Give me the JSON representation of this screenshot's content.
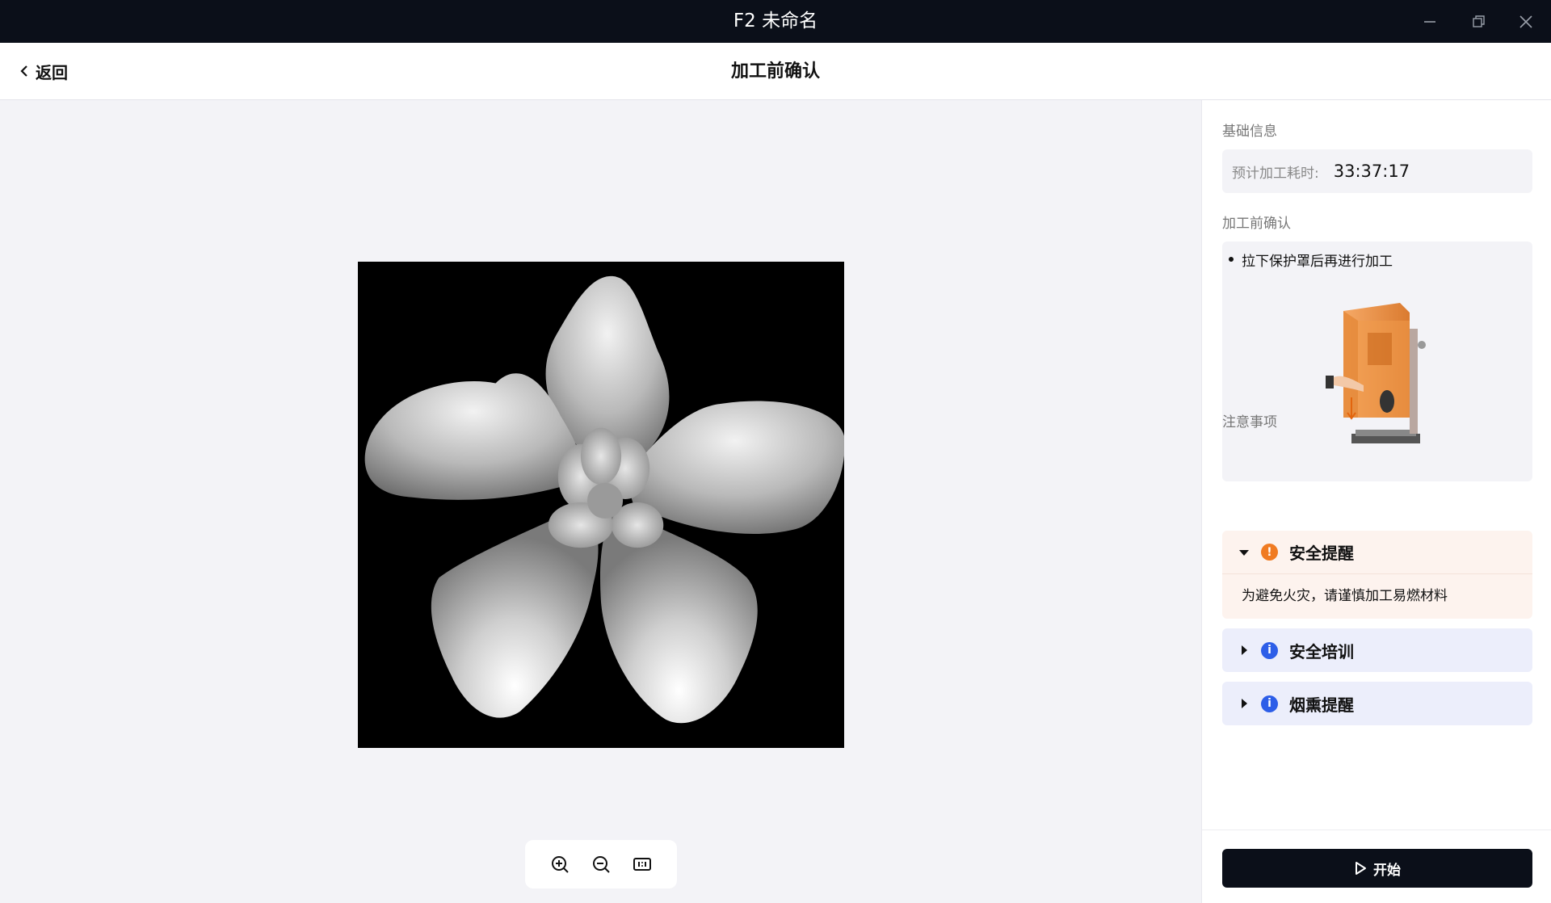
{
  "window": {
    "title": "F2 未命名"
  },
  "header": {
    "back_label": "返回",
    "title": "加工前确认"
  },
  "panel": {
    "basic_info_title": "基础信息",
    "time_label": "预计加工耗时:",
    "time_value": "33:37:17",
    "confirm_title": "加工前确认",
    "confirm_items": [
      "拉下保护罩后再进行加工"
    ],
    "notes_title": "注意事项",
    "notes": [
      {
        "label": "安全提醒",
        "expanded": true,
        "icon": "warning-icon",
        "color": "#f07b22",
        "body": "为避免火灾，请谨慎加工易燃材料"
      },
      {
        "label": "安全培训",
        "expanded": false,
        "icon": "info-icon",
        "color": "#2d5ee8"
      },
      {
        "label": "烟熏提醒",
        "expanded": false,
        "icon": "info-icon",
        "color": "#2d5ee8"
      }
    ],
    "start_label": "开始"
  },
  "toolbar": {
    "zoom_in": "zoom-in-icon",
    "zoom_out": "zoom-out-icon",
    "fit": "fit-one-to-one-icon"
  },
  "colors": {
    "titlebar": "#0b0f19",
    "accent": "#0b0f19",
    "warning": "#f07b22",
    "info": "#2d5ee8"
  }
}
